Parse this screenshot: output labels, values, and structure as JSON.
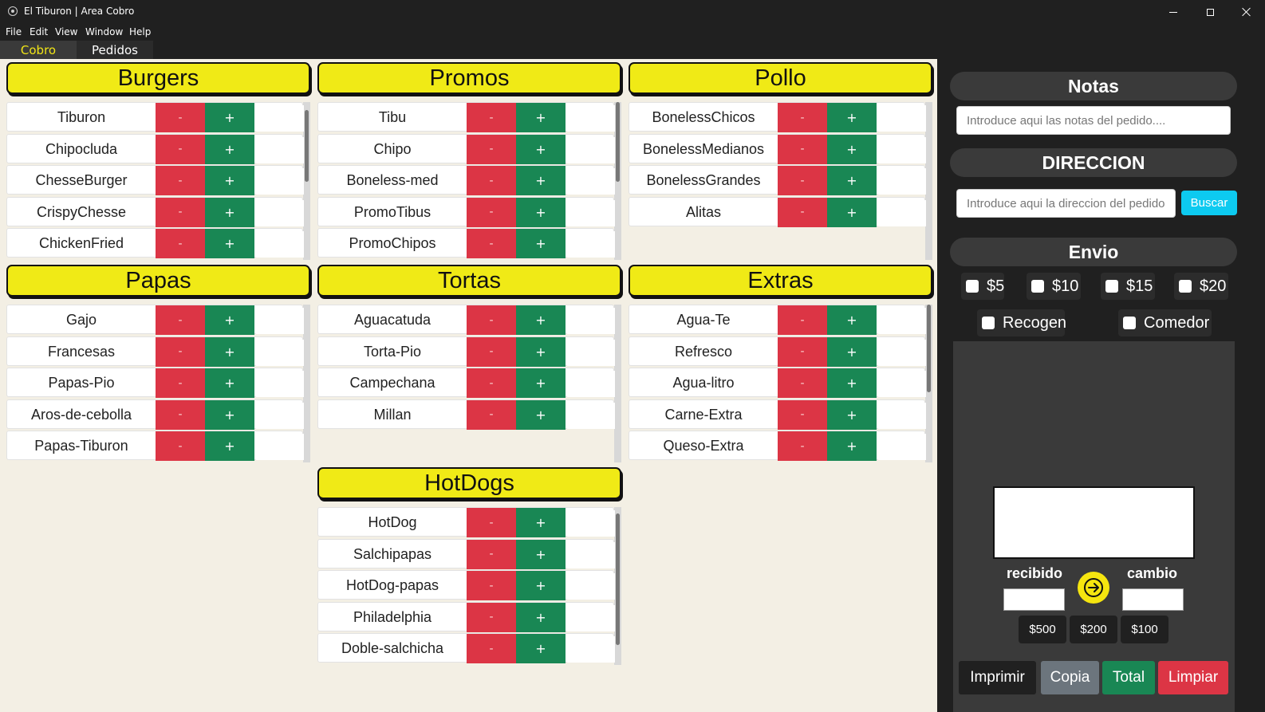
{
  "window": {
    "title": "El Tiburon | Area Cobro"
  },
  "menu": [
    "File",
    "Edit",
    "View",
    "Window",
    "Help"
  ],
  "tabs": [
    "Cobro",
    "Pedidos"
  ],
  "categories": [
    {
      "title": "Burgers",
      "items": [
        "Tiburon",
        "Chipocluda",
        "ChesseBurger",
        "CrispyChesse",
        "ChickenFried"
      ]
    },
    {
      "title": "Promos",
      "items": [
        "Tibu",
        "Chipo",
        "Boneless-med",
        "PromoTibus",
        "PromoChipos"
      ]
    },
    {
      "title": "Pollo",
      "items": [
        "BonelessChicos",
        "BonelessMedianos",
        "BonelessGrandes",
        "Alitas"
      ]
    },
    {
      "title": "Papas",
      "items": [
        "Gajo",
        "Francesas",
        "Papas-Pio",
        "Aros-de-cebolla",
        "Papas-Tiburon"
      ]
    },
    {
      "title": "Tortas",
      "items": [
        "Aguacatuda",
        "Torta-Pio",
        "Campechana",
        "Millan"
      ]
    },
    {
      "title": "Extras",
      "items": [
        "Agua-Te",
        "Refresco",
        "Agua-litro",
        "Carne-Extra",
        "Queso-Extra"
      ]
    },
    {
      "title": "HotDogs",
      "items": [
        "HotDog",
        "Salchipapas",
        "HotDog-papas",
        "Philadelphia",
        "Doble-salchicha"
      ]
    }
  ],
  "item_buttons": {
    "minus": "-",
    "plus": "+"
  },
  "notas": {
    "title": "Notas",
    "placeholder": "Introduce aqui las notas del pedido...."
  },
  "direccion": {
    "title": "DIRECCION",
    "placeholder": "Introduce aqui la direccion del pedido",
    "buscar": "Buscar"
  },
  "envio": {
    "title": "Envio",
    "options": [
      "$5",
      "$10",
      "$15",
      "$20"
    ],
    "extra": [
      "Recogen",
      "Comedor"
    ]
  },
  "cambio": {
    "recibido": "recibido",
    "cambio": "cambio",
    "bills": [
      "$500",
      "$200",
      "$100"
    ]
  },
  "actions": {
    "imprimir": "Imprimir",
    "copia": "Copia",
    "total": "Total",
    "limpiar": "Limpiar"
  },
  "colors": {
    "header_yellow": "#f0ea16",
    "minus_red": "#dc3545",
    "plus_green": "#198754",
    "buscar_cyan": "#0dcaf0",
    "active_tab": "#f0e416"
  }
}
